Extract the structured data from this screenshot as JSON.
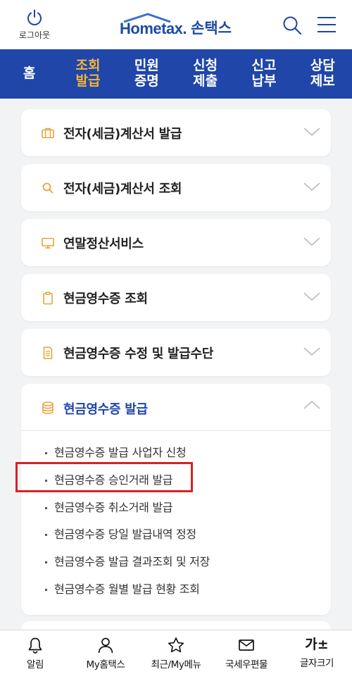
{
  "header": {
    "logout_label": "로그아웃",
    "logo_en": "Hometax.",
    "logo_ko": "손택스"
  },
  "nav": {
    "items": [
      {
        "label": "홈",
        "active": false
      },
      {
        "label": "조회\n발급",
        "active": true
      },
      {
        "label": "민원\n증명",
        "active": false
      },
      {
        "label": "신청\n제출",
        "active": false
      },
      {
        "label": "신고\n납부",
        "active": false
      },
      {
        "label": "상담\n제보",
        "active": false
      }
    ]
  },
  "menu": {
    "cards": [
      {
        "label": "전자(세금)계산서 발급",
        "icon": "briefcase-icon"
      },
      {
        "label": "전자(세금)계산서 조회",
        "icon": "search-icon"
      },
      {
        "label": "연말정산서비스",
        "icon": "monitor-icon"
      },
      {
        "label": "현금영수증 조회",
        "icon": "clipboard-icon"
      },
      {
        "label": "현금영수증 수정 및 발급수단",
        "icon": "document-icon"
      }
    ],
    "open_card": {
      "label": "현금영수증 발급",
      "icon": "database-icon",
      "items": [
        "현금영수증 발급 사업자 신청",
        "현금영수증 승인거래 발급",
        "현금영수증 취소거래 발급",
        "현금영수증 당일 발급내역 정정",
        "현금영수증 발급 결과조회 및 저장",
        "현금영수증 월별 발급 현황 조회"
      ],
      "highlighted_index": 1
    }
  },
  "bottom": {
    "items": [
      {
        "label": "알림",
        "icon": "bell-icon"
      },
      {
        "label": "My홈택스",
        "icon": "person-icon"
      },
      {
        "label": "최근/My메뉴",
        "icon": "star-icon"
      },
      {
        "label": "국세우편물",
        "icon": "mail-icon"
      },
      {
        "label": "글자크기",
        "icon": "font-size-icon",
        "glyph": "가±"
      }
    ]
  },
  "colors": {
    "brand_blue": "#1f46a8",
    "active_orange": "#f5b33a",
    "icon_orange": "#e8a33a",
    "highlight_red": "#d4232a"
  }
}
